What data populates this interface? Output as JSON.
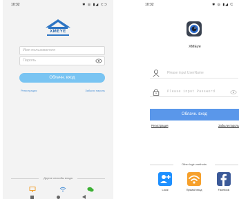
{
  "left": {
    "status": {
      "time": "10:32",
      "icons": "✱ ◎ ▮◢ ⊂⊃"
    },
    "brand": "XMEYE",
    "username_placeholder": "Имя пользователя",
    "password_placeholder": "Пароль",
    "login_button": "Облачн. вход",
    "register_link": "Регистрация",
    "forgot_link": "Забыли пароль",
    "other_methods": "Другие способы входа",
    "icons": [
      "monitor-icon",
      "wifi-icon",
      "wechat-icon"
    ],
    "colors": {
      "accent": "#79c4f2",
      "brand": "#1d5fa8",
      "background": "#f3f3f3"
    }
  },
  "right": {
    "status": {
      "time": "10:32",
      "icons": "✱ ◎ ▮◢ C"
    },
    "app_name": "XMEye",
    "username_placeholder": "Please input UserName",
    "password_placeholder": "Please input Password",
    "login_button": "Облачн. вход",
    "register_link": "Регистрация",
    "forgot_link": "Забыли пароль",
    "other_methods": "Other login methods",
    "methods": [
      {
        "label": "Local",
        "icon": "add-user-icon"
      },
      {
        "label": "Прямой вход",
        "icon": "wifi-icon"
      },
      {
        "label": "Facebook",
        "icon": "facebook-icon"
      }
    ],
    "colors": {
      "accent": "#5a97ea",
      "local": "#1e90ff",
      "direct": "#f6a02b",
      "facebook": "#3b5998"
    }
  }
}
